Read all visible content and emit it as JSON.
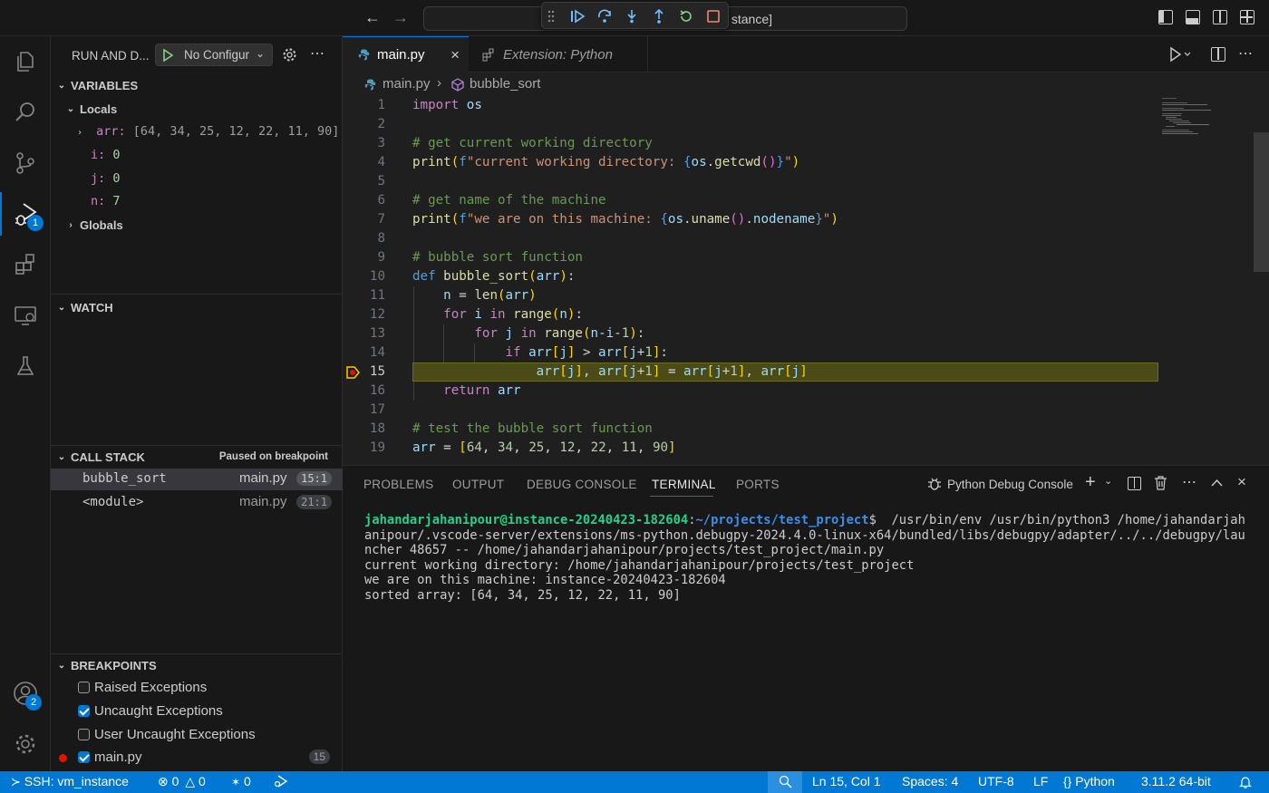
{
  "titlebar": {
    "command_center_text": "stance]",
    "back_icon": "arrow-left-icon",
    "forward_icon": "arrow-right-icon"
  },
  "activity": {
    "run_debug_badge": "1",
    "accounts_badge": "2"
  },
  "sidebar": {
    "title": "RUN AND D...",
    "config_select": "No Configur",
    "variables": {
      "title": "VARIABLES",
      "locals_label": "Locals",
      "locals": [
        {
          "name": "arr:",
          "value": "[64, 34, 25, 12, 22, 11, 90]"
        },
        {
          "name": "i:",
          "value": "0"
        },
        {
          "name": "j:",
          "value": "0"
        },
        {
          "name": "n:",
          "value": "7"
        }
      ],
      "globals_label": "Globals"
    },
    "watch": {
      "title": "WATCH"
    },
    "call_stack": {
      "title": "CALL STACK",
      "status": "Paused on breakpoint",
      "frames": [
        {
          "name": "bubble_sort",
          "file": "main.py",
          "pos": "15:1"
        },
        {
          "name": "<module>",
          "file": "main.py",
          "pos": "21:1"
        }
      ]
    },
    "breakpoints": {
      "title": "BREAKPOINTS",
      "items": [
        {
          "label": "Raised Exceptions",
          "checked": false
        },
        {
          "label": "Uncaught Exceptions",
          "checked": true
        },
        {
          "label": "User Uncaught Exceptions",
          "checked": false
        },
        {
          "label": "main.py",
          "checked": true,
          "line": "15"
        }
      ]
    }
  },
  "editor": {
    "tabs": [
      {
        "label": "main.py",
        "active": true
      },
      {
        "label": "Extension: Python",
        "active": false
      }
    ],
    "breadcrumb": {
      "file": "main.py",
      "symbol": "bubble_sort"
    },
    "current_line": 15,
    "lines": [
      {
        "num": "1",
        "text": "import os"
      },
      {
        "num": "2",
        "text": ""
      },
      {
        "num": "3",
        "text": "# get current working directory"
      },
      {
        "num": "4",
        "text": "print(f\"current working directory: {os.getcwd()}\")"
      },
      {
        "num": "5",
        "text": ""
      },
      {
        "num": "6",
        "text": "# get name of the machine"
      },
      {
        "num": "7",
        "text": "print(f\"we are on this machine: {os.uname().nodename}\")"
      },
      {
        "num": "8",
        "text": ""
      },
      {
        "num": "9",
        "text": "# bubble sort function"
      },
      {
        "num": "10",
        "text": "def bubble_sort(arr):"
      },
      {
        "num": "11",
        "text": "    n = len(arr)"
      },
      {
        "num": "12",
        "text": "    for i in range(n):"
      },
      {
        "num": "13",
        "text": "        for j in range(n-i-1):"
      },
      {
        "num": "14",
        "text": "            if arr[j] > arr[j+1]:"
      },
      {
        "num": "15",
        "text": "                arr[j], arr[j+1] = arr[j+1], arr[j]"
      },
      {
        "num": "16",
        "text": "    return arr"
      },
      {
        "num": "17",
        "text": ""
      },
      {
        "num": "18",
        "text": "# test the bubble sort function"
      },
      {
        "num": "19",
        "text": "arr = [64, 34, 25, 12, 22, 11, 90]"
      }
    ]
  },
  "panel": {
    "tabs": [
      "PROBLEMS",
      "OUTPUT",
      "DEBUG CONSOLE",
      "TERMINAL",
      "PORTS"
    ],
    "active_tab": "TERMINAL",
    "terminal_name": "Python Debug Console",
    "terminal": {
      "prompt_user": "jahandarjahanipour@instance-20240423-182604",
      "prompt_sep": ":",
      "prompt_path": "~/projects/test_project",
      "prompt_end": "$ ",
      "command": " /usr/bin/env /usr/bin/python3 /home/jahandarjahanipour/.vscode-server/extensions/ms-python.debugpy-2024.4.0-linux-x64/bundled/libs/debugpy/adapter/../../debugpy/launcher 48657 -- /home/jahandarjahanipour/projects/test_project/main.py",
      "output": [
        "current working directory: /home/jahandarjahanipour/projects/test_project",
        "we are on this machine: instance-20240423-182604",
        "sorted array: [64, 34, 25, 12, 22, 11, 90]"
      ]
    }
  },
  "statusbar": {
    "remote": "SSH: vm_instance",
    "errors": "0",
    "warnings": "0",
    "ports": "0",
    "position": "Ln 15, Col 1",
    "spaces": "Spaces: 4",
    "encoding": "UTF-8",
    "eol": "LF",
    "language": "Python",
    "interpreter": "3.11.2 64-bit"
  },
  "colors": {
    "accent": "#0078d4",
    "breakpoint_red": "#e51400",
    "current_line_highlight": "#4b4b18"
  }
}
